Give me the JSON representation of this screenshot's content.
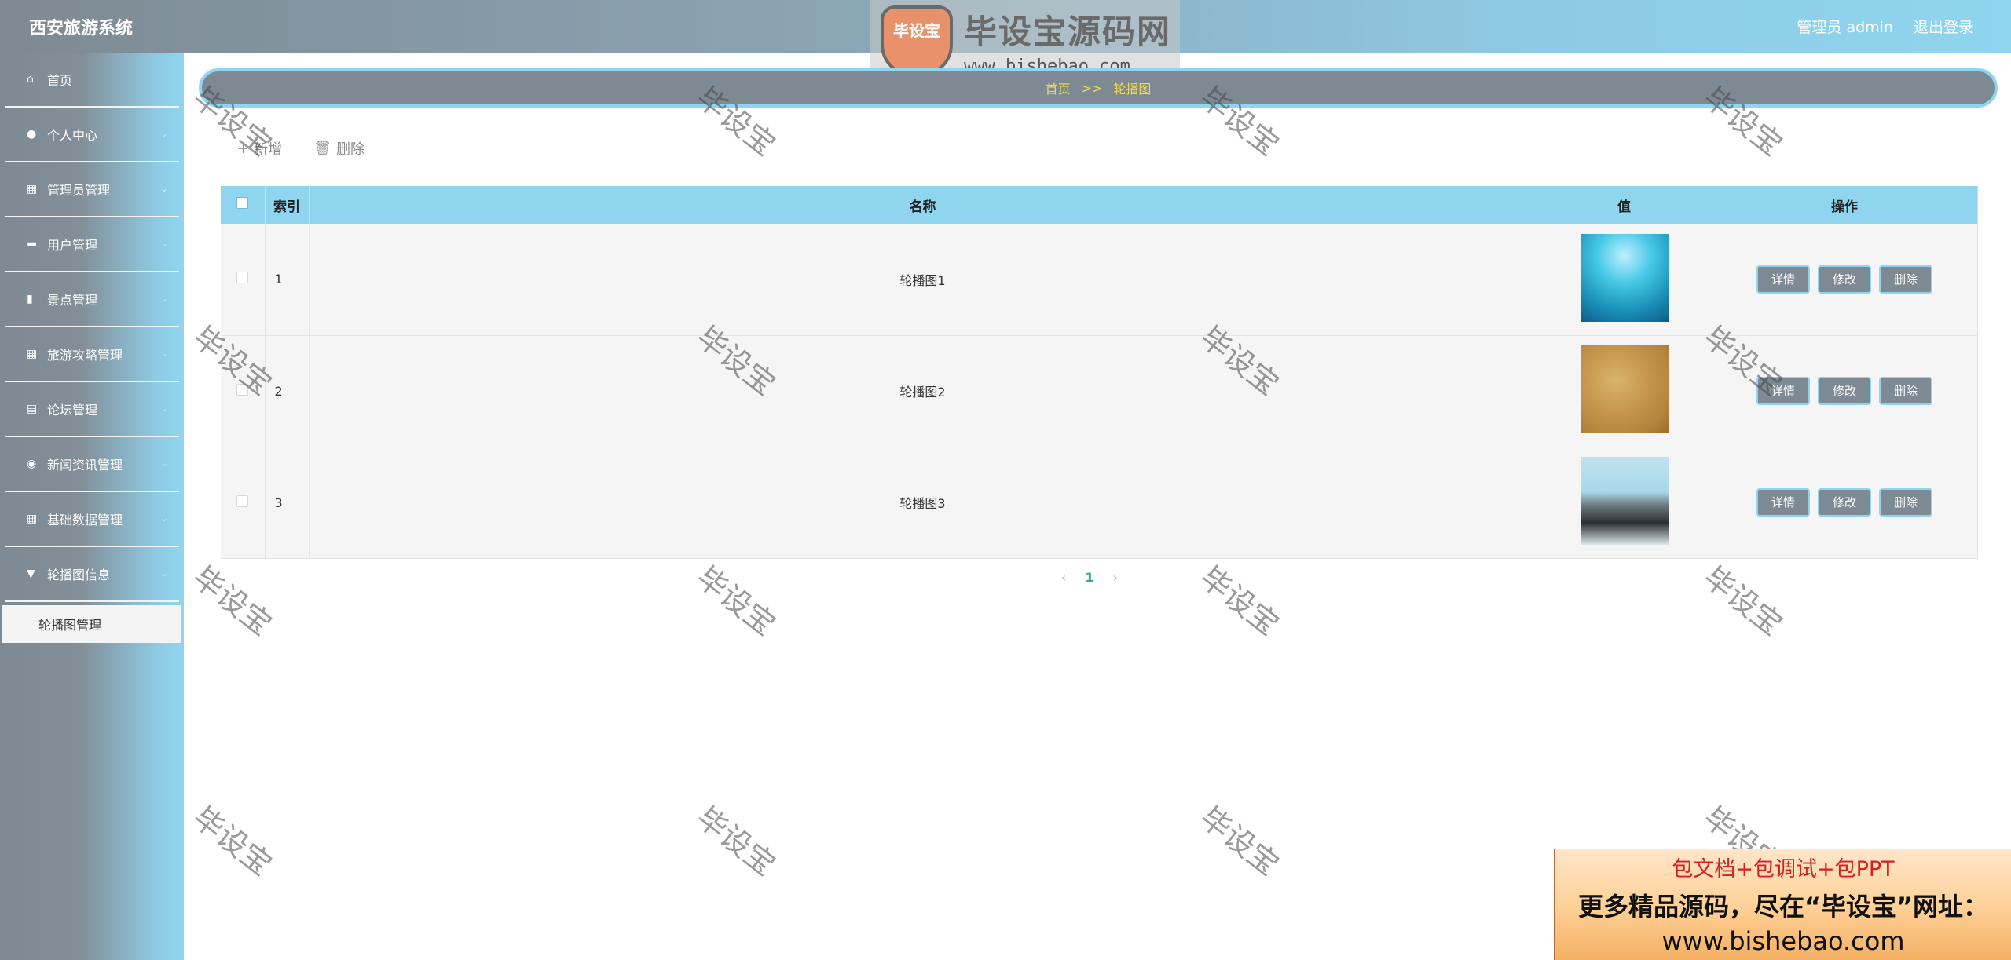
{
  "header": {
    "app_title": "西安旅游系统",
    "user_label": "管理员 admin",
    "logout_label": "退出登录",
    "logo_badge": "毕设宝",
    "logo_text": "毕设宝源码网",
    "logo_url": "www.bishebao.com"
  },
  "sidebar": {
    "items": [
      {
        "label": "首页",
        "icon": "home-icon"
      },
      {
        "label": "个人中心",
        "icon": "user-icon"
      },
      {
        "label": "管理员管理",
        "icon": "grid-icon"
      },
      {
        "label": "用户管理",
        "icon": "chat-icon"
      },
      {
        "label": "景点管理",
        "icon": "chart-icon"
      },
      {
        "label": "旅游攻略管理",
        "icon": "grid-icon"
      },
      {
        "label": "论坛管理",
        "icon": "document-icon"
      },
      {
        "label": "新闻资讯管理",
        "icon": "location-icon"
      },
      {
        "label": "基础数据管理",
        "icon": "grid-icon"
      },
      {
        "label": "轮播图信息",
        "icon": "trophy-icon"
      }
    ],
    "submenu": {
      "label": "轮播图管理"
    }
  },
  "breadcrumb": {
    "home": "首页",
    "sep": ">>",
    "current": "轮播图"
  },
  "toolbar": {
    "add_label": "新增",
    "delete_label": "删除"
  },
  "table": {
    "headers": {
      "index": "索引",
      "name": "名称",
      "value": "值",
      "ops": "操作"
    },
    "rows": [
      {
        "index": "1",
        "name": "轮播图1",
        "image": "blue sky image"
      },
      {
        "index": "2",
        "name": "轮播图2",
        "image": "brown texture image"
      },
      {
        "index": "3",
        "name": "轮播图3",
        "image": "city skyline image"
      }
    ],
    "ops": {
      "detail": "详情",
      "edit": "修改",
      "delete": "删除"
    }
  },
  "pagination": {
    "prev": "‹",
    "current": "1",
    "next": "›"
  },
  "watermark": {
    "text": "毕设宝"
  },
  "promo": {
    "line1": "包文档+包调试+包PPT",
    "line2": "更多精品源码，尽在“毕设宝”网址：",
    "line3": "www.bishebao.com"
  },
  "colors": {
    "accent": "#8fd5f0",
    "gray": "#7e8a93",
    "breadcrumb_text": "#f7d94c",
    "page_active": "#2fa89b"
  }
}
